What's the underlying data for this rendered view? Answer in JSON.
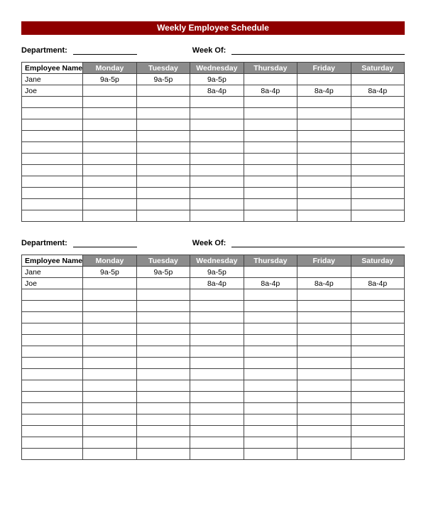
{
  "title": "Weekly Employee Schedule",
  "labels": {
    "department": "Department:",
    "week_of": "Week Of:",
    "employee_name": "Employee Name"
  },
  "days": [
    "Monday",
    "Tuesday",
    "Wednesday",
    "Thursday",
    "Friday",
    "Saturday"
  ],
  "blocks": [
    {
      "department": "",
      "week_of": "",
      "rows": [
        {
          "name": "Jane",
          "cells": [
            "9a-5p",
            "9a-5p",
            "9a-5p",
            "",
            "",
            ""
          ]
        },
        {
          "name": "Joe",
          "cells": [
            "",
            "",
            "8a-4p",
            "8a-4p",
            "8a-4p",
            "8a-4p"
          ]
        },
        {
          "name": "",
          "cells": [
            "",
            "",
            "",
            "",
            "",
            ""
          ]
        },
        {
          "name": "",
          "cells": [
            "",
            "",
            "",
            "",
            "",
            ""
          ]
        },
        {
          "name": "",
          "cells": [
            "",
            "",
            "",
            "",
            "",
            ""
          ]
        },
        {
          "name": "",
          "cells": [
            "",
            "",
            "",
            "",
            "",
            ""
          ]
        },
        {
          "name": "",
          "cells": [
            "",
            "",
            "",
            "",
            "",
            ""
          ]
        },
        {
          "name": "",
          "cells": [
            "",
            "",
            "",
            "",
            "",
            ""
          ]
        },
        {
          "name": "",
          "cells": [
            "",
            "",
            "",
            "",
            "",
            ""
          ]
        },
        {
          "name": "",
          "cells": [
            "",
            "",
            "",
            "",
            "",
            ""
          ]
        },
        {
          "name": "",
          "cells": [
            "",
            "",
            "",
            "",
            "",
            ""
          ]
        },
        {
          "name": "",
          "cells": [
            "",
            "",
            "",
            "",
            "",
            ""
          ]
        },
        {
          "name": "",
          "cells": [
            "",
            "",
            "",
            "",
            "",
            ""
          ]
        }
      ]
    },
    {
      "department": "",
      "week_of": "",
      "rows": [
        {
          "name": "Jane",
          "cells": [
            "9a-5p",
            "9a-5p",
            "9a-5p",
            "",
            "",
            ""
          ]
        },
        {
          "name": "Joe",
          "cells": [
            "",
            "",
            "8a-4p",
            "8a-4p",
            "8a-4p",
            "8a-4p"
          ]
        },
        {
          "name": "",
          "cells": [
            "",
            "",
            "",
            "",
            "",
            ""
          ]
        },
        {
          "name": "",
          "cells": [
            "",
            "",
            "",
            "",
            "",
            ""
          ]
        },
        {
          "name": "",
          "cells": [
            "",
            "",
            "",
            "",
            "",
            ""
          ]
        },
        {
          "name": "",
          "cells": [
            "",
            "",
            "",
            "",
            "",
            ""
          ]
        },
        {
          "name": "",
          "cells": [
            "",
            "",
            "",
            "",
            "",
            ""
          ]
        },
        {
          "name": "",
          "cells": [
            "",
            "",
            "",
            "",
            "",
            ""
          ]
        },
        {
          "name": "",
          "cells": [
            "",
            "",
            "",
            "",
            "",
            ""
          ]
        },
        {
          "name": "",
          "cells": [
            "",
            "",
            "",
            "",
            "",
            ""
          ]
        },
        {
          "name": "",
          "cells": [
            "",
            "",
            "",
            "",
            "",
            ""
          ]
        },
        {
          "name": "",
          "cells": [
            "",
            "",
            "",
            "",
            "",
            ""
          ]
        },
        {
          "name": "",
          "cells": [
            "",
            "",
            "",
            "",
            "",
            ""
          ]
        },
        {
          "name": "",
          "cells": [
            "",
            "",
            "",
            "",
            "",
            ""
          ]
        },
        {
          "name": "",
          "cells": [
            "",
            "",
            "",
            "",
            "",
            ""
          ]
        },
        {
          "name": "",
          "cells": [
            "",
            "",
            "",
            "",
            "",
            ""
          ]
        },
        {
          "name": "",
          "cells": [
            "",
            "",
            "",
            "",
            "",
            ""
          ]
        }
      ]
    }
  ]
}
